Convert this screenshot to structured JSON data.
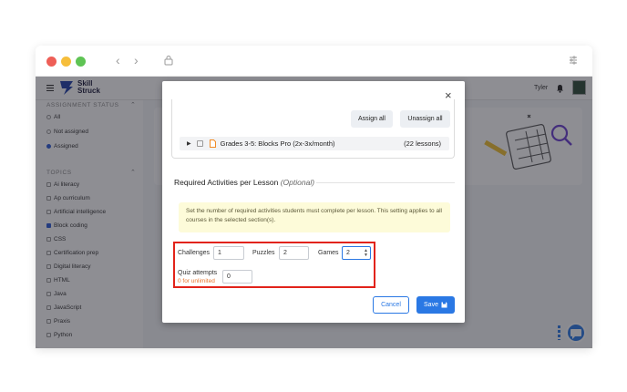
{
  "browser": {
    "traffic_lights": [
      "#ee5f57",
      "#f6be3b",
      "#5fc454"
    ],
    "back_icon": "chevron-left-icon",
    "forward_icon": "chevron-right-icon",
    "lock_icon": "lock-icon",
    "settings_icon": "sliders-icon"
  },
  "app": {
    "logo_line1": "Skill",
    "logo_line2": "Struck",
    "user_name": "Tyler",
    "accent": "#2a78e4"
  },
  "sidebar": {
    "assignment_status_header": "ASSIGNMENT STATUS",
    "status_options": [
      {
        "label": "All",
        "selected": false
      },
      {
        "label": "Not assigned",
        "selected": false
      },
      {
        "label": "Assigned",
        "selected": true
      }
    ],
    "topics_header": "TOPICS",
    "topics": [
      {
        "label": "Ai literacy",
        "checked": false
      },
      {
        "label": "Ap curriculum",
        "checked": false
      },
      {
        "label": "Artificial intelligence",
        "checked": false
      },
      {
        "label": "Block coding",
        "checked": true
      },
      {
        "label": "CSS",
        "checked": false
      },
      {
        "label": "Certification prep",
        "checked": false
      },
      {
        "label": "Digital literacy",
        "checked": false
      },
      {
        "label": "HTML",
        "checked": false
      },
      {
        "label": "Java",
        "checked": false
      },
      {
        "label": "JavaScript",
        "checked": false
      },
      {
        "label": "Praxis",
        "checked": false
      },
      {
        "label": "Python",
        "checked": false
      }
    ]
  },
  "modal": {
    "close_label": "×",
    "assign_all": "Assign all",
    "unassign_all": "Unassign all",
    "course_name": "Grades 3-5: Blocks Pro (2x-3x/month)",
    "course_lessons": "(22 lessons)",
    "section_title": "Required Activities per Lesson",
    "section_optional": "(Optional)",
    "notice": "Set the number of required activities students must complete per lesson. This setting applies to all courses in the selected section(s).",
    "fields": {
      "challenges_label": "Challenges",
      "challenges_value": "1",
      "puzzles_label": "Puzzles",
      "puzzles_value": "2",
      "games_label": "Games",
      "games_value": "2",
      "quiz_label": "Quiz attempts",
      "quiz_hint": "0 for unlimited",
      "quiz_value": "0"
    },
    "cancel": "Cancel",
    "save": "Save"
  }
}
